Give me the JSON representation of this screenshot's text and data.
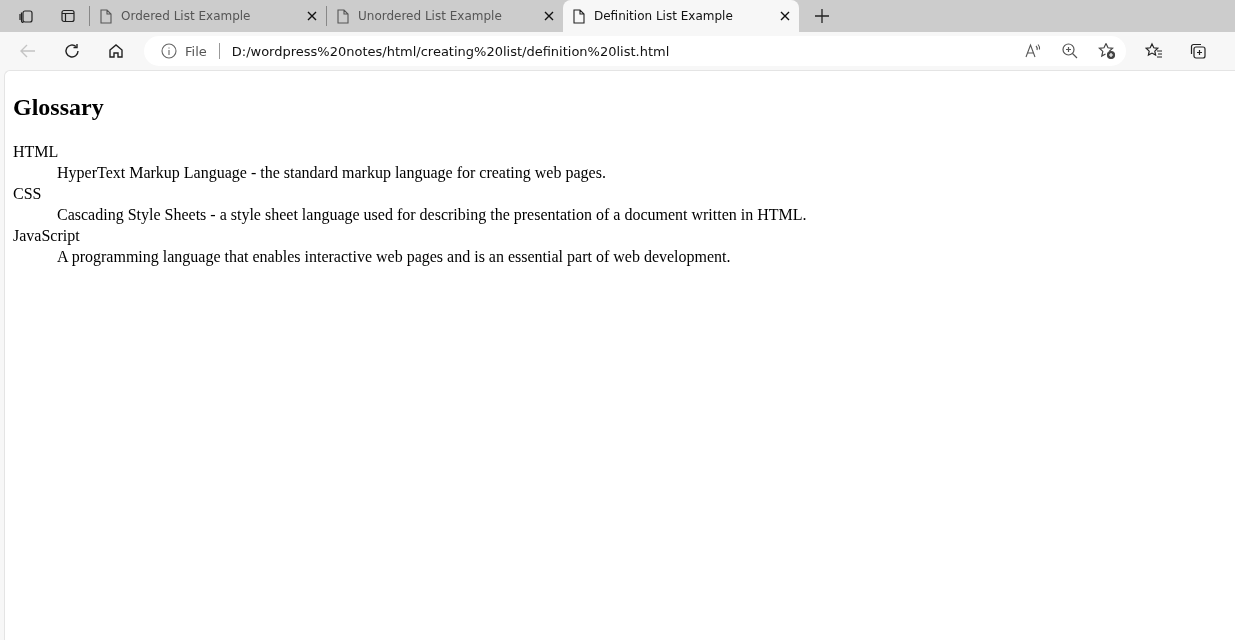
{
  "tabs": [
    {
      "title": "Ordered List Example",
      "selected": false
    },
    {
      "title": "Unordered List Example",
      "selected": false
    },
    {
      "title": "Definition List Example",
      "selected": true
    }
  ],
  "address_bar": {
    "scheme": "File",
    "url": "D:/wordpress%20notes/html/creating%20list/definition%20list.html"
  },
  "page": {
    "heading": "Glossary",
    "definitions": [
      {
        "term": "HTML",
        "description": "HyperText Markup Language - the standard markup language for creating web pages."
      },
      {
        "term": "CSS",
        "description": "Cascading Style Sheets - a style sheet language used for describing the presentation of a document written in HTML."
      },
      {
        "term": "JavaScript",
        "description": "A programming language that enables interactive web pages and is an essential part of web development."
      }
    ]
  }
}
